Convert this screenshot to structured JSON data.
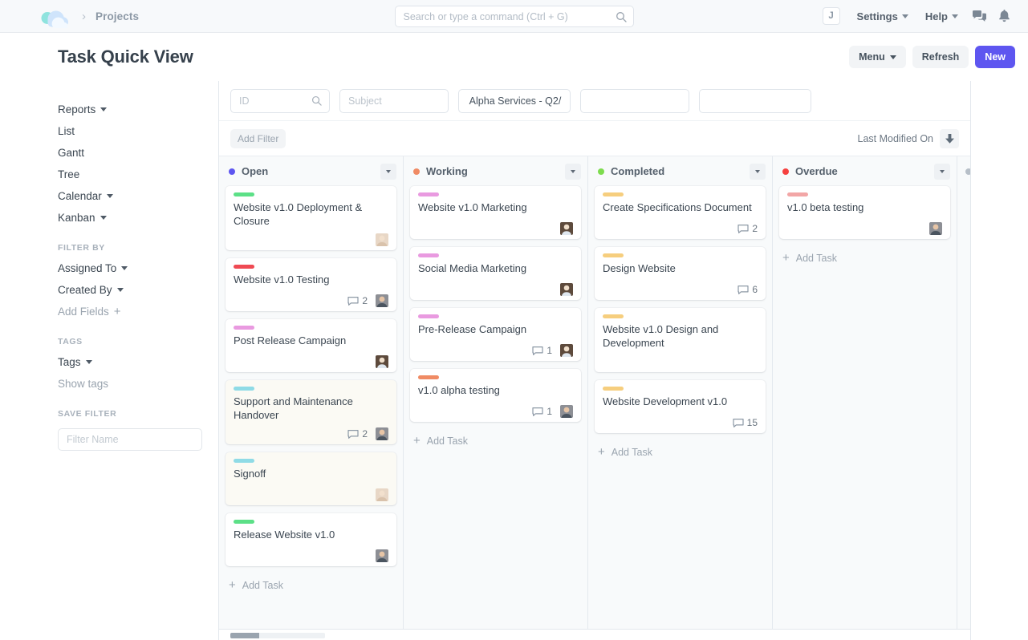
{
  "navbar": {
    "logo_icon": "cloud-logo-icon",
    "breadcrumb_separator": "›",
    "breadcrumb": "Projects",
    "search": {
      "placeholder": "Search or type a command (Ctrl + G)",
      "value": "",
      "icon": "search-icon"
    },
    "user_initial": "J",
    "settings_label": "Settings",
    "help_label": "Help",
    "chat_icon": "chat-bubble-icon",
    "bell_icon": "bell-icon"
  },
  "header": {
    "title": "Task Quick View",
    "menu_label": "Menu",
    "refresh_label": "Refresh",
    "new_label": "New"
  },
  "sidebar": {
    "views": [
      {
        "label": "Reports",
        "has_caret": true
      },
      {
        "label": "List",
        "has_caret": false
      },
      {
        "label": "Gantt",
        "has_caret": false
      },
      {
        "label": "Tree",
        "has_caret": false
      },
      {
        "label": "Calendar",
        "has_caret": true
      },
      {
        "label": "Kanban",
        "has_caret": true
      }
    ],
    "filter_by_heading": "FILTER BY",
    "filters": [
      {
        "label": "Assigned To",
        "has_caret": true
      },
      {
        "label": "Created By",
        "has_caret": true
      }
    ],
    "add_fields_label": "Add Fields",
    "tags_heading": "TAGS",
    "tags_label": "Tags",
    "show_tags_label": "Show tags",
    "save_filter_heading": "SAVE FILTER",
    "filter_name_placeholder": "Filter Name",
    "filter_name_value": ""
  },
  "filter_bar": {
    "id_placeholder": "ID",
    "id_value": "",
    "subject_placeholder": "Subject",
    "subject_value": "",
    "project_value": "Alpha Services - Q2/",
    "blank1_value": "",
    "blank2_value": "",
    "add_filter_label": "Add Filter",
    "sort_label": "Last Modified On",
    "sort_direction_icon": "arrow-down-icon"
  },
  "board": {
    "add_task_label": "Add Task",
    "columns": [
      {
        "title": "Open",
        "dot_color": "#5e56f0",
        "cards": [
          {
            "title": "Website v1.0 Deployment & Closure",
            "bar_color": "#5ce087",
            "comments": null,
            "avatar": "avatar-a",
            "tinted": false
          },
          {
            "title": "Website v1.0 Testing",
            "bar_color": "#ef4a53",
            "comments": "2",
            "avatar": "avatar-b",
            "tinted": false
          },
          {
            "title": "Post Release Campaign",
            "bar_color": "#e99ae0",
            "comments": null,
            "avatar": "avatar-c",
            "tinted": false
          },
          {
            "title": "Support and Maintenance Handover",
            "bar_color": "#8fdbe6",
            "comments": "2",
            "avatar": "avatar-b",
            "tinted": true
          },
          {
            "title": "Signoff",
            "bar_color": "#8fdbe6",
            "comments": null,
            "avatar": "avatar-a",
            "tinted": true
          },
          {
            "title": "Release Website v1.0",
            "bar_color": "#5ce087",
            "comments": null,
            "avatar": "avatar-b",
            "tinted": false
          }
        ]
      },
      {
        "title": "Working",
        "dot_color": "#f08b64",
        "cards": [
          {
            "title": "Website v1.0 Marketing",
            "bar_color": "#e99ae0",
            "comments": null,
            "avatar": "avatar-c",
            "tinted": false
          },
          {
            "title": "Social Media Marketing",
            "bar_color": "#e99ae0",
            "comments": null,
            "avatar": "avatar-c",
            "tinted": false
          },
          {
            "title": "Pre-Release Campaign",
            "bar_color": "#e99ae0",
            "comments": "1",
            "avatar": "avatar-c",
            "tinted": false
          },
          {
            "title": "v1.0 alpha testing",
            "bar_color": "#f08b64",
            "comments": "1",
            "avatar": "avatar-b",
            "tinted": false
          }
        ]
      },
      {
        "title": "Completed",
        "dot_color": "#7ddc4e",
        "cards": [
          {
            "title": "Create Specifications Document",
            "bar_color": "#f6ce7e",
            "comments": "2",
            "avatar": null,
            "tinted": false
          },
          {
            "title": "Design Website",
            "bar_color": "#f6ce7e",
            "comments": "6",
            "avatar": null,
            "tinted": false
          },
          {
            "title": "Website v1.0 Design and Development",
            "bar_color": "#f6ce7e",
            "comments": null,
            "avatar": null,
            "tinted": false
          },
          {
            "title": "Website Development v1.0",
            "bar_color": "#f6ce7e",
            "comments": "15",
            "avatar": null,
            "tinted": false
          }
        ]
      },
      {
        "title": "Overdue",
        "dot_color": "#f6403f",
        "cards": [
          {
            "title": "v1.0 beta testing",
            "bar_color": "#f2a6a6",
            "comments": null,
            "avatar": "avatar-b",
            "tinted": false
          }
        ]
      }
    ],
    "partial_column": {
      "dot_color": "#b7bfc8"
    }
  }
}
